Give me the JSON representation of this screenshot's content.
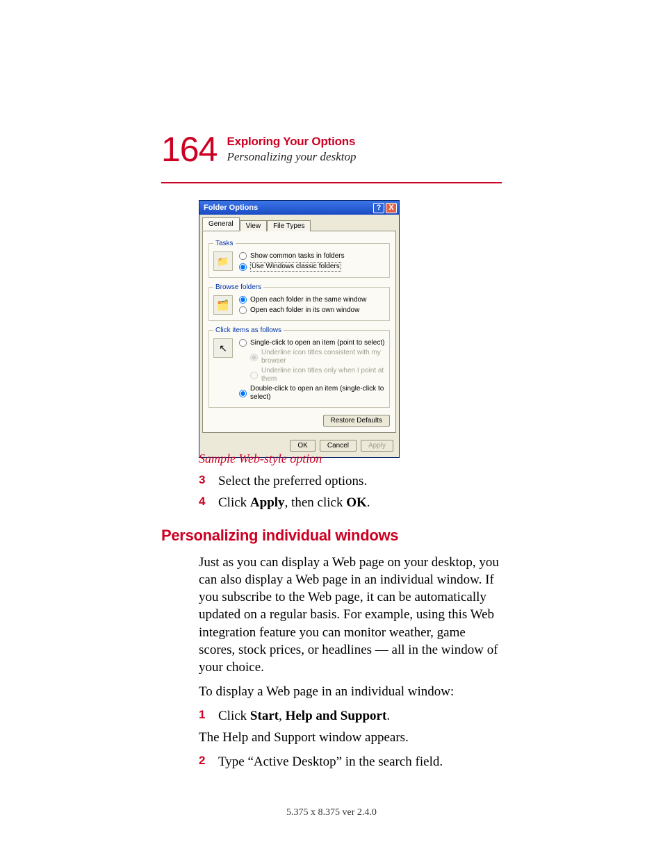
{
  "header": {
    "page_number": "164",
    "chapter": "Exploring Your Options",
    "section": "Personalizing your desktop"
  },
  "dialog": {
    "title": "Folder Options",
    "help_label": "?",
    "close_label": "X",
    "tabs": [
      "General",
      "View",
      "File Types"
    ],
    "groups": {
      "tasks": {
        "legend": "Tasks",
        "opt1": "Show common tasks in folders",
        "opt2": "Use Windows classic folders"
      },
      "browse": {
        "legend": "Browse folders",
        "opt1": "Open each folder in the same window",
        "opt2": "Open each folder in its own window"
      },
      "click": {
        "legend": "Click items as follows",
        "opt1": "Single-click to open an item (point to select)",
        "sub1": "Underline icon titles consistent with my browser",
        "sub2": "Underline icon titles only when I point at them",
        "opt2": "Double-click to open an item (single-click to select)"
      }
    },
    "restore": "Restore Defaults",
    "ok": "OK",
    "cancel": "Cancel",
    "apply": "Apply"
  },
  "caption": "Sample Web-style option",
  "steps_a": {
    "s3_num": "3",
    "s3_txt": "Select the preferred options.",
    "s4_num": "4",
    "s4_prefix": "Click ",
    "s4_b1": "Apply",
    "s4_mid": ", then click ",
    "s4_b2": "OK",
    "s4_suffix": "."
  },
  "h2": "Personalizing individual windows",
  "para1": "Just as you can display a Web page on your desktop, you can also display a Web page in an individual window. If you subscribe to the Web page, it can be automatically updated on a regular basis. For example, using this Web integration feature you can monitor weather, game scores, stock prices, or headlines — all in the window of your choice.",
  "para2": "To display a Web page in an individual window:",
  "steps_b": {
    "s1_num": "1",
    "s1_prefix": "Click ",
    "s1_b1": "Start",
    "s1_mid": ", ",
    "s1_b2": "Help and Support",
    "s1_suffix": "."
  },
  "para3": "The Help and Support window appears.",
  "steps_c": {
    "s2_num": "2",
    "s2_txt": "Type “Active Desktop” in the search field."
  },
  "footer": "5.375 x 8.375 ver 2.4.0"
}
